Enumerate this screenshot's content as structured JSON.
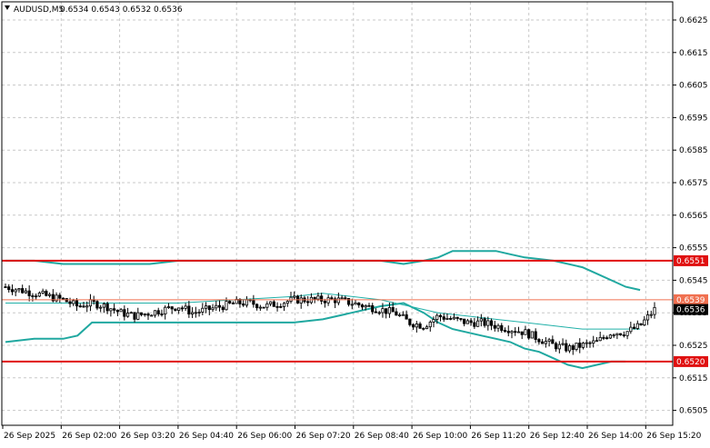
{
  "header": {
    "menu_icon": "triangle-down-icon",
    "symbol": "AUDUSD,M5",
    "ohlc": "0.6534 0.6543 0.6532 0.6536"
  },
  "price_axis": {
    "min": 0.6505,
    "max": 0.6625,
    "ticks": [
      "0.6625",
      "0.6615",
      "0.6605",
      "0.6595",
      "0.6585",
      "0.6575",
      "0.6565",
      "0.6555",
      "0.6545",
      "0.6535",
      "0.6525",
      "0.6515",
      "0.6505"
    ]
  },
  "time_axis": {
    "labels": [
      "26 Sep 2025",
      "26 Sep 02:00",
      "26 Sep 03:20",
      "26 Sep 04:40",
      "26 Sep 06:00",
      "26 Sep 07:20",
      "26 Sep 08:40",
      "26 Sep 10:00",
      "26 Sep 11:20",
      "26 Sep 12:40",
      "26 Sep 14:00",
      "26 Sep 15:20"
    ]
  },
  "levels": {
    "resistance": {
      "label": "0.6551",
      "value": 0.6551,
      "color": "#e01010"
    },
    "support": {
      "label": "0.6520",
      "value": 0.652,
      "color": "#e01010"
    },
    "reference": {
      "label": "0.6539",
      "value": 0.6539,
      "color": "#f07050"
    },
    "current": {
      "label": "0.6536",
      "value": 0.6536,
      "color": "#000000"
    }
  },
  "colors": {
    "grid": "#c8c8c8",
    "candle": "#000000",
    "bands": "#20a8a0",
    "ma": "#20b0a8"
  },
  "chart_data": {
    "type": "candlestick",
    "symbol": "AUDUSD",
    "timeframe": "M5",
    "ylim": [
      0.6505,
      0.6625
    ],
    "candles_count": 192,
    "close_path": [
      [
        0,
        0.6543
      ],
      [
        5,
        0.6542
      ],
      [
        10,
        0.6541
      ],
      [
        15,
        0.654
      ],
      [
        20,
        0.6539
      ],
      [
        25,
        0.6537
      ],
      [
        30,
        0.6538
      ],
      [
        35,
        0.6537
      ],
      [
        40,
        0.6535
      ],
      [
        45,
        0.6534
      ],
      [
        50,
        0.6535
      ],
      [
        55,
        0.6536
      ],
      [
        60,
        0.6537
      ],
      [
        65,
        0.6535
      ],
      [
        70,
        0.6536
      ],
      [
        75,
        0.6537
      ],
      [
        80,
        0.6538
      ],
      [
        85,
        0.6538
      ],
      [
        90,
        0.6537
      ],
      [
        95,
        0.6538
      ],
      [
        100,
        0.6539
      ],
      [
        105,
        0.6539
      ],
      [
        110,
        0.6539
      ],
      [
        115,
        0.6539
      ],
      [
        120,
        0.6538
      ],
      [
        125,
        0.6537
      ],
      [
        130,
        0.6536
      ],
      [
        135,
        0.6535
      ],
      [
        140,
        0.6532
      ],
      [
        145,
        0.6531
      ],
      [
        150,
        0.6534
      ],
      [
        155,
        0.6533
      ],
      [
        160,
        0.6532
      ],
      [
        165,
        0.6532
      ],
      [
        170,
        0.6531
      ],
      [
        175,
        0.653
      ],
      [
        180,
        0.6529
      ],
      [
        185,
        0.6527
      ],
      [
        190,
        0.6525
      ],
      [
        195,
        0.6524
      ],
      [
        200,
        0.6525
      ],
      [
        205,
        0.6526
      ],
      [
        210,
        0.6529
      ],
      [
        215,
        0.6529
      ],
      [
        220,
        0.6531
      ],
      [
        225,
        0.6536
      ]
    ],
    "ma_path": [
      [
        0,
        0.6538
      ],
      [
        20,
        0.6538
      ],
      [
        40,
        0.6538
      ],
      [
        60,
        0.6538
      ],
      [
        80,
        0.6539
      ],
      [
        100,
        0.654
      ],
      [
        110,
        0.6541
      ],
      [
        120,
        0.654
      ],
      [
        130,
        0.6539
      ],
      [
        140,
        0.6537
      ],
      [
        150,
        0.6535
      ],
      [
        160,
        0.6534
      ],
      [
        170,
        0.6533
      ],
      [
        180,
        0.6532
      ],
      [
        190,
        0.6531
      ],
      [
        200,
        0.653
      ],
      [
        210,
        0.653
      ],
      [
        220,
        0.653
      ]
    ],
    "band_upper": [
      [
        0,
        0.6551
      ],
      [
        10,
        0.6551
      ],
      [
        20,
        0.655
      ],
      [
        30,
        0.655
      ],
      [
        40,
        0.655
      ],
      [
        50,
        0.655
      ],
      [
        60,
        0.6551
      ],
      [
        70,
        0.6551
      ],
      [
        80,
        0.6551
      ],
      [
        90,
        0.6551
      ],
      [
        100,
        0.6551
      ],
      [
        110,
        0.6551
      ],
      [
        120,
        0.6551
      ],
      [
        130,
        0.6551
      ],
      [
        138,
        0.655
      ],
      [
        145,
        0.6551
      ],
      [
        150,
        0.6552
      ],
      [
        155,
        0.6554
      ],
      [
        160,
        0.6554
      ],
      [
        165,
        0.6554
      ],
      [
        170,
        0.6554
      ],
      [
        175,
        0.6553
      ],
      [
        180,
        0.6552
      ],
      [
        190,
        0.6551
      ],
      [
        200,
        0.6549
      ],
      [
        205,
        0.6547
      ],
      [
        210,
        0.6545
      ],
      [
        215,
        0.6543
      ],
      [
        220,
        0.6542
      ]
    ],
    "band_lower": [
      [
        0,
        0.6526
      ],
      [
        10,
        0.6527
      ],
      [
        20,
        0.6527
      ],
      [
        25,
        0.6528
      ],
      [
        30,
        0.6532
      ],
      [
        40,
        0.6532
      ],
      [
        50,
        0.6532
      ],
      [
        60,
        0.6532
      ],
      [
        70,
        0.6532
      ],
      [
        80,
        0.6532
      ],
      [
        90,
        0.6532
      ],
      [
        100,
        0.6532
      ],
      [
        110,
        0.6533
      ],
      [
        120,
        0.6535
      ],
      [
        130,
        0.6537
      ],
      [
        138,
        0.6538
      ],
      [
        145,
        0.6535
      ],
      [
        150,
        0.6532
      ],
      [
        155,
        0.653
      ],
      [
        160,
        0.6529
      ],
      [
        165,
        0.6528
      ],
      [
        170,
        0.6527
      ],
      [
        175,
        0.6526
      ],
      [
        180,
        0.6524
      ],
      [
        185,
        0.6523
      ],
      [
        190,
        0.6521
      ],
      [
        195,
        0.6519
      ],
      [
        200,
        0.6518
      ],
      [
        205,
        0.6519
      ],
      [
        210,
        0.652
      ],
      [
        215,
        0.652
      ]
    ]
  }
}
